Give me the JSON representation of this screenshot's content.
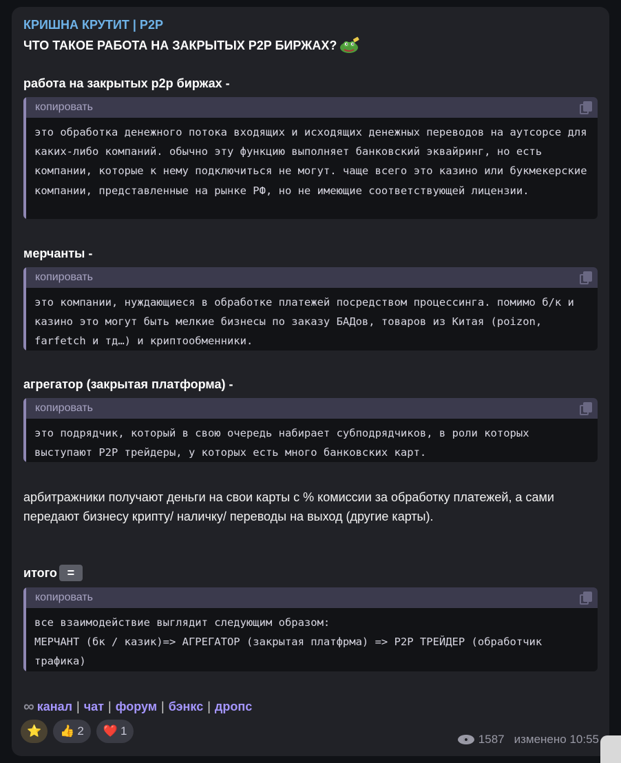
{
  "channel_name": "КРИШНА КРУТИТ | P2P",
  "headline": "ЧТО ТАКОЕ РАБОТА НА ЗАКРЫТЫХ P2P БИРЖАХ?",
  "copy_label": "копировать",
  "sections": [
    {
      "title": "работа на закрытых p2p биржах -",
      "code": "это обработка денежного потока входящих и исходящих денежных переводов на аутсорсе для каких-либо компаний. обычно эту функцию выполняет банковский эквайринг, но есть компании, которые к нему подключиться не могут. чаще всего это казино или букмекерские компании, представленные на рынке РФ, но не имеющие соответствующей лицензии."
    },
    {
      "title": "мерчанты -",
      "code": "это компании, нуждающиеся в обработке платежей посредством процессинга. помимо б/к и казино это могут быть мелкие бизнесы по заказу БАДов, товаров из Китая (poizon, farfetch и тд…) и криптообменники."
    },
    {
      "title": "агрегатор (закрытая платформа) -",
      "code": "это подрядчик, который в свою очередь набирает субподрядчиков, в роли которых выступают P2P трейдеры, у которых есть много банковских карт."
    }
  ],
  "paragraph": "арбитражники получают деньги на свои карты с % комиссии за обработку платежей, а сами передают бизнесу крипту/ наличку/ переводы на выход (другие карты).",
  "summary": {
    "title": "итого",
    "badge": "=",
    "code_line1": "все взаимодействие выглядит следующим образом:",
    "code_line2": "МЕРЧАНТ (бк / казик)=> АГРЕГАТОР (закрытая платфрма) => P2P ТРЕЙДЕР (обработчик трафика)"
  },
  "links": {
    "symbol": "∞",
    "items": [
      "канал",
      "чат",
      "форум",
      "бэнкс",
      "дропс"
    ],
    "separator": "|"
  },
  "reactions": [
    {
      "emoji": "⭐",
      "count": ""
    },
    {
      "emoji": "👍",
      "count": "2"
    },
    {
      "emoji": "❤️",
      "count": "1"
    }
  ],
  "views": "1587",
  "edited": "изменено 10:55",
  "colors": {
    "accent_link": "#a596ff",
    "channel": "#6fb3e8",
    "bubble": "#212227",
    "code_bar": "#8f87b3"
  }
}
